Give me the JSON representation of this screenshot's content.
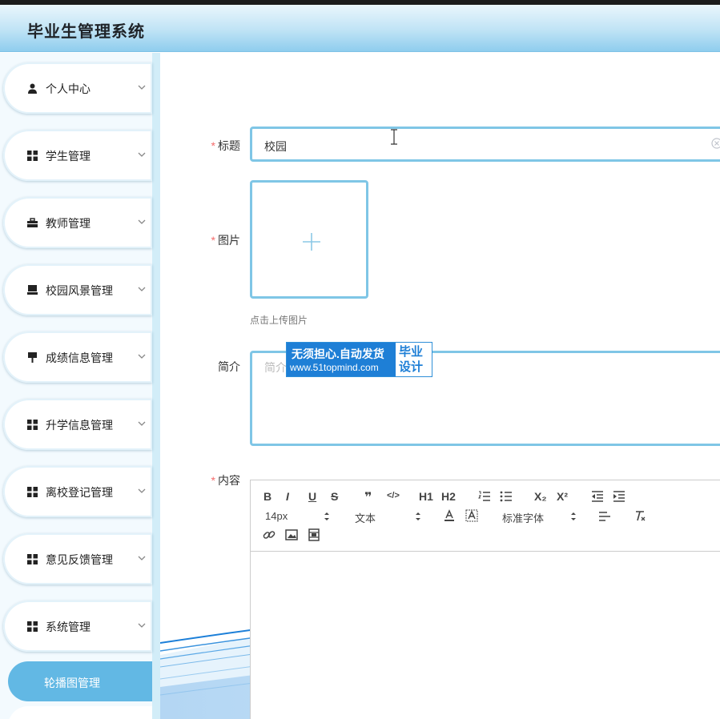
{
  "app": {
    "title": "毕业生管理系统"
  },
  "sidebar": {
    "items": [
      {
        "label": "个人中心",
        "icon": "user-icon"
      },
      {
        "label": "学生管理",
        "icon": "grid-icon"
      },
      {
        "label": "教师管理",
        "icon": "briefcase-icon"
      },
      {
        "label": "校园风景管理",
        "icon": "monitor-icon"
      },
      {
        "label": "成绩信息管理",
        "icon": "stand-icon"
      },
      {
        "label": "升学信息管理",
        "icon": "grid-icon"
      },
      {
        "label": "离校登记管理",
        "icon": "grid-icon"
      },
      {
        "label": "意见反馈管理",
        "icon": "grid-icon"
      },
      {
        "label": "系统管理",
        "icon": "grid-icon"
      }
    ],
    "active_sub": "轮播图管理"
  },
  "form": {
    "title_label": "标题",
    "title_value": "校园",
    "image_label": "图片",
    "upload_hint": "点击上传图片",
    "intro_label": "简介",
    "intro_placeholder": "简介",
    "content_label": "内容"
  },
  "editor": {
    "font_size": "14px",
    "block_format": "文本",
    "font_family": "标准字体",
    "buttons": {
      "bold": "B",
      "italic": "I",
      "underline": "U",
      "strike": "S",
      "quote": "❞",
      "code": "</>",
      "h1": "H1",
      "h2": "H2",
      "sub": "X₂",
      "sup": "X²"
    }
  },
  "watermark": {
    "line1": "无须担心.自动发货",
    "line2": "www.51topmind.com",
    "right1": "毕业",
    "right2": "设计"
  },
  "colors": {
    "accent": "#62b8e4",
    "border": "#7fc6e6",
    "required": "#f56c6c"
  }
}
